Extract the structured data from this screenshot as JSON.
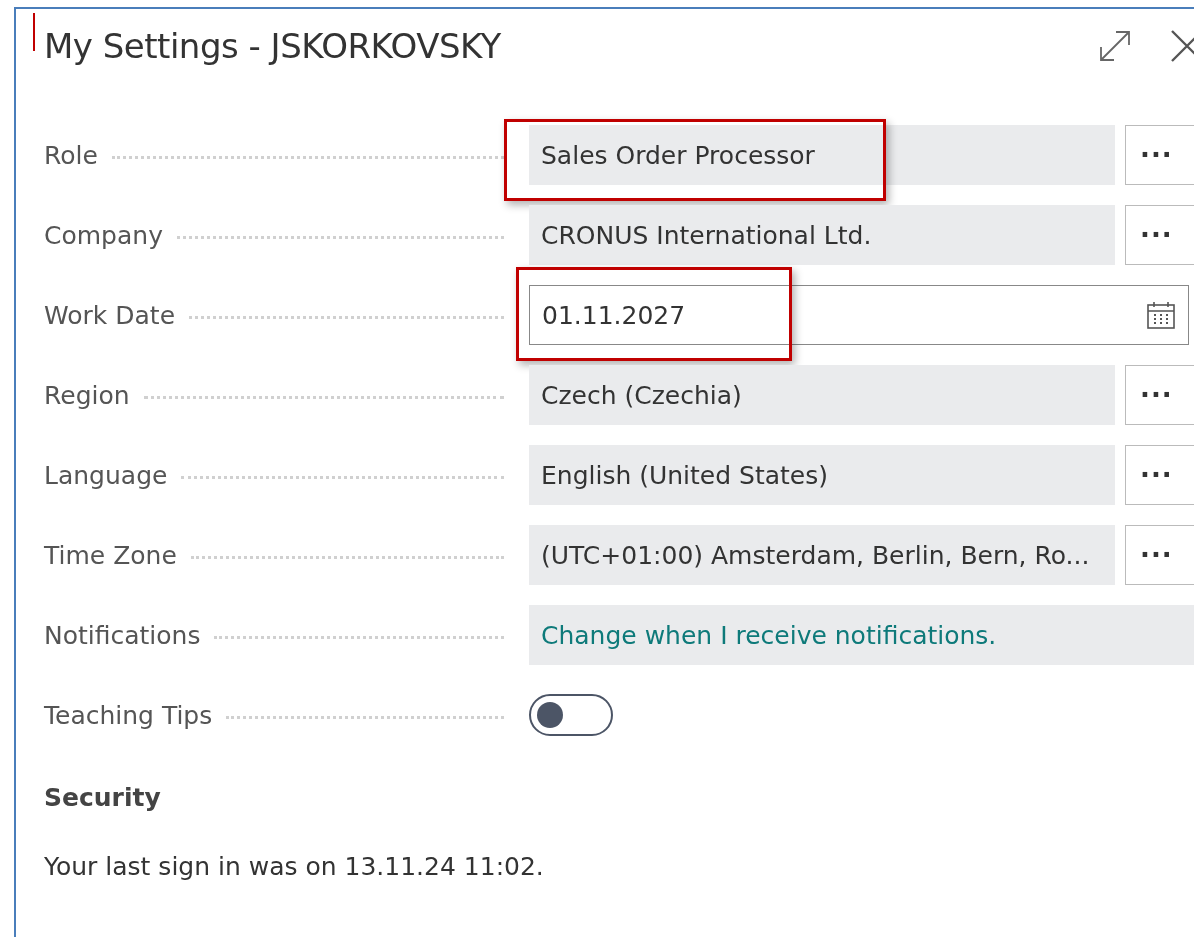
{
  "window": {
    "title": "My Settings - JSKORKOVSKY"
  },
  "fields": [
    {
      "kind": "lookup",
      "label": "Role",
      "value": "Sales Order Processor",
      "button": "···",
      "highlighted": true
    },
    {
      "kind": "lookup",
      "label": "Company",
      "value": "CRONUS International Ltd.",
      "button": "···",
      "highlighted": false
    },
    {
      "kind": "date",
      "label": "Work Date",
      "value": "01.11.2027",
      "highlighted": true
    },
    {
      "kind": "lookup",
      "label": "Region",
      "value": "Czech (Czechia)",
      "button": "···",
      "highlighted": false
    },
    {
      "kind": "lookup",
      "label": "Language",
      "value": "English (United States)",
      "button": "···",
      "highlighted": false
    },
    {
      "kind": "lookup",
      "label": "Time Zone",
      "value": "(UTC+01:00) Amsterdam, Berlin, Bern, Ro...",
      "button": "···",
      "highlighted": false
    },
    {
      "kind": "link",
      "label": "Notifications",
      "value": "Change when I receive notifications.",
      "highlighted": false
    },
    {
      "kind": "toggle",
      "label": "Teaching Tips",
      "on": false,
      "highlighted": false
    }
  ],
  "security": {
    "heading": "Security",
    "text": "Your last sign in was on 13.11.24 11:02."
  }
}
